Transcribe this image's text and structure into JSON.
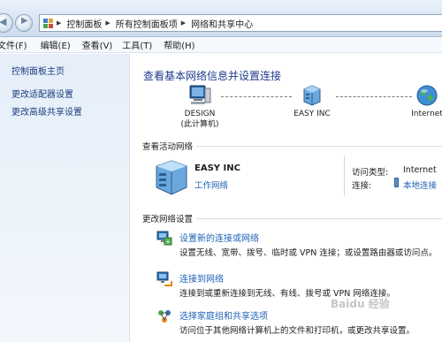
{
  "address": {
    "segments": [
      "控制面板",
      "所有控制面板项",
      "网络和共享中心"
    ]
  },
  "menu": [
    "文件(F)",
    "编辑(E)",
    "查看(V)",
    "工具(T)",
    "帮助(H)"
  ],
  "sidebar": {
    "home": "控制面板主页",
    "links": [
      "更改适配器设置",
      "更改高级共享设置"
    ]
  },
  "main": {
    "title": "查看基本网络信息并设置连接",
    "map": {
      "computer_name": "DESIGN",
      "computer_sub": "(此计算机)",
      "network_name": "EASY INC",
      "internet_label": "Internet"
    },
    "active_section": "查看活动网络",
    "active": {
      "name": "EASY INC",
      "type": "工作网络",
      "access_label": "访问类型:",
      "access_value": "Internet",
      "conn_label": "连接:",
      "conn_value": "本地连接"
    },
    "change_section": "更改网络设置",
    "tasks": [
      {
        "title": "设置新的连接或网络",
        "desc": "设置无线、宽带、拨号、临时或 VPN 连接；或设置路由器或访问点。"
      },
      {
        "title": "连接到网络",
        "desc": "连接到或重新连接到无线、有线、拨号或 VPN 网络连接。"
      },
      {
        "title": "选择家庭组和共享选项",
        "desc": "访问位于其他网络计算机上的文件和打印机，或更改共享设置。"
      }
    ]
  },
  "watermark": "Baidu 经验"
}
